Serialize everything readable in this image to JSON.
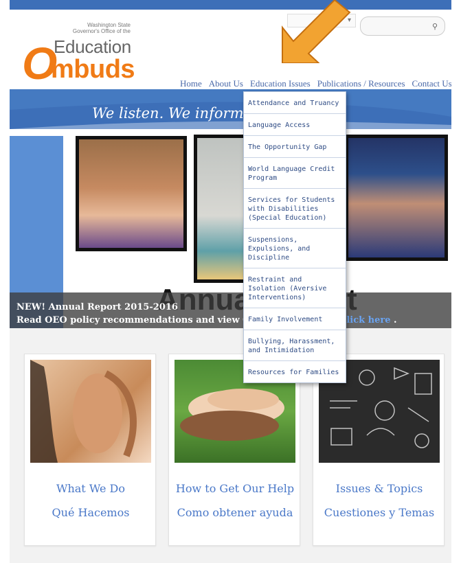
{
  "logo": {
    "line1": "Washington State",
    "line2": "Governor's Office of the",
    "education": "Education",
    "o": "O",
    "mbuds": "mbuds"
  },
  "nav": {
    "items": [
      "Home",
      "About Us",
      "Education Issues",
      "Publications / Resources",
      "Contact Us"
    ]
  },
  "banner": {
    "text": "We listen.  We inform.  W                        blems."
  },
  "dropdown": {
    "items": [
      "Attendance and Truancy",
      "Language Access",
      "The Opportunity Gap",
      "World Language Credit Program",
      "Services for Students with Disabilities (Special Education)",
      "Suspensions, Expulsions, and Discipline",
      "Restraint and Isolation (Aversive Interventions)",
      "Family Involvement",
      "Bullying, Harassment, and Intimidation",
      "Resources for Families"
    ]
  },
  "news": {
    "line1": "NEW! Annual Report 2015-2016",
    "line2": "Read OEO policy recommendations and view O",
    "link": "Click here",
    "link_after": " .",
    "big_word_1": "Annua",
    "big_word_2": "rt"
  },
  "cards": [
    {
      "title": "What We Do",
      "subtitle": "Qué Hacemos"
    },
    {
      "title": "How to Get Our Help",
      "subtitle": "Como obtener ayuda"
    },
    {
      "title": "Issues & Topics",
      "subtitle": "Cuestiones y Temas"
    }
  ],
  "colors": {
    "brand_orange": "#f07b16",
    "brand_blue": "#3d6fb8",
    "link_blue": "#4a78c8"
  }
}
